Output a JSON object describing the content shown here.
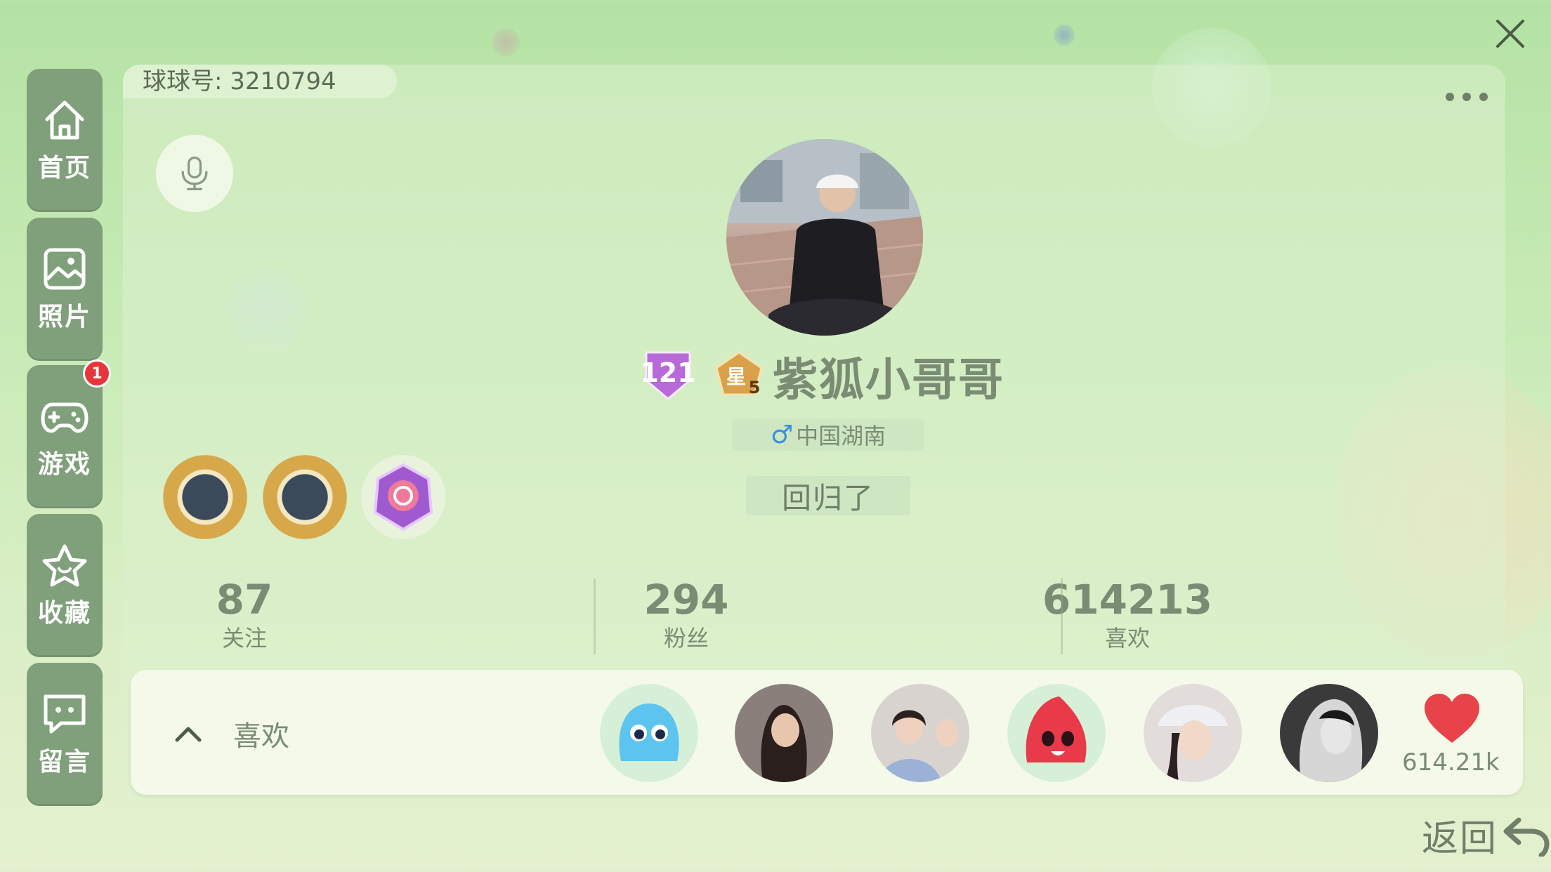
{
  "header": {
    "uid_label": "球球号: 3210794"
  },
  "sidebar": {
    "items": [
      {
        "label": "首页",
        "icon": "home-icon"
      },
      {
        "label": "照片",
        "icon": "photo-icon"
      },
      {
        "label": "游戏",
        "icon": "gamepad-icon",
        "badge": "1"
      },
      {
        "label": "收藏",
        "icon": "star-icon"
      },
      {
        "label": "留言",
        "icon": "message-icon"
      }
    ]
  },
  "profile": {
    "level": "121",
    "star_badge": "星",
    "star_level": "5",
    "username": "紫狐小哥哥",
    "gender_symbol": "♂",
    "location": "中国湖南",
    "signature": "回归了"
  },
  "stats": [
    {
      "value": "87",
      "label": "关注"
    },
    {
      "value": "294",
      "label": "粉丝"
    },
    {
      "value": "614213",
      "label": "喜欢"
    }
  ],
  "likes": {
    "label": "喜欢",
    "count": "614.21k"
  },
  "footer": {
    "back_label": "返回"
  },
  "colors": {
    "sidebar_bg": "#7fa07a",
    "badge_red": "#e8343a",
    "heart_red": "#e8434a",
    "text_green": "#7a8c74"
  }
}
